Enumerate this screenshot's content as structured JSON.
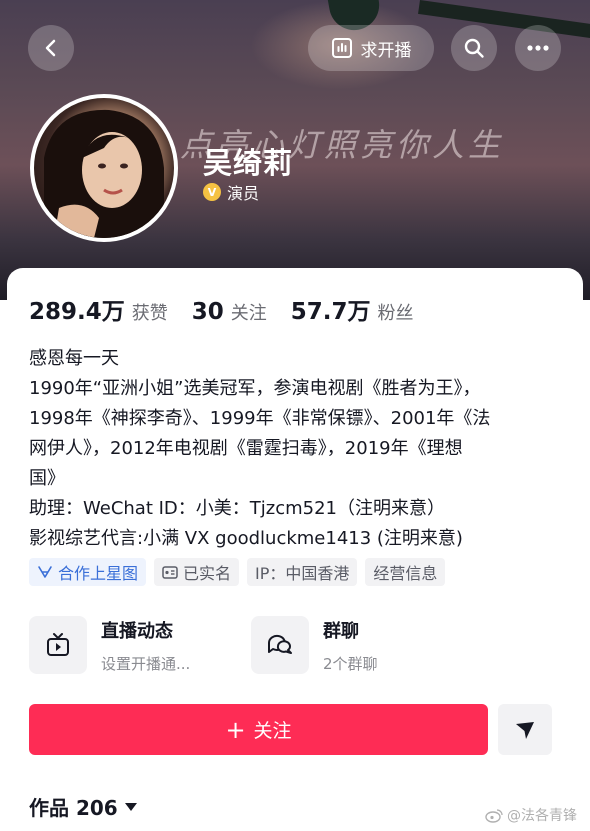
{
  "header": {
    "back_icon": "chevron-left-icon",
    "live_request_label": "求开播",
    "search_icon": "search-icon",
    "more_icon": "more-icon",
    "slogan": "点亮心灯照亮你人生"
  },
  "profile": {
    "name": "吴绮莉",
    "verified_badge": "V",
    "verified_title": "演员"
  },
  "stats": {
    "likes_value": "289.4万",
    "likes_label": "获赞",
    "following_value": "30",
    "following_label": "关注",
    "followers_value": "57.7万",
    "followers_label": "粉丝"
  },
  "bio": {
    "lines": [
      "感恩每一天",
      "1990年“亚洲小姐”选美冠军，参演电视剧《胜者为王》，",
      "1998年《神探李奇》、1999年《非常保镖》、2001年《法",
      "网伊人》，2012年电视剧《雷霆扫毒》，2019年《理想",
      "国》",
      "助理：WeChat ID：小美：Tjzcm521（注明来意）",
      "影视综艺代言:小满 VX goodluckme1413 (注明来意)"
    ]
  },
  "tags": {
    "star_map": "合作上星图",
    "real_name": "已实名",
    "ip": "IP：中国香港",
    "business": "经营信息"
  },
  "features": {
    "live_title": "直播动态",
    "live_sub": "设置开播通...",
    "group_title": "群聊",
    "group_sub": "2个群聊"
  },
  "actions": {
    "follow_label": "关注",
    "follow_plus": "+"
  },
  "works": {
    "label": "作品 206"
  },
  "watermark": {
    "text": "@法各青锋"
  },
  "colors": {
    "accent": "#fe2c55",
    "verified": "#f5c243",
    "tag_blue": "#3a6fd8"
  }
}
